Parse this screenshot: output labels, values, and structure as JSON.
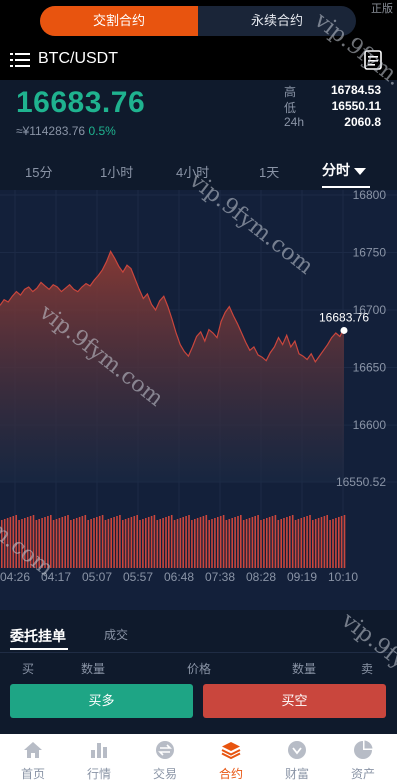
{
  "top": {
    "corner_text": "正版",
    "seg_delivery": "交割合约",
    "seg_perpetual": "永续合约"
  },
  "header": {
    "pair": "BTC/USDT"
  },
  "ticker": {
    "price": "16683.76",
    "cny": "≈¥114283.76",
    "change": "0.5%",
    "high_label": "高",
    "high": "16784.53",
    "low_label": "低",
    "low": "16550.11",
    "vol_label": "24h",
    "vol": "2060.8"
  },
  "intervals": [
    "15分",
    "1小时",
    "4小时",
    "1天",
    "分时"
  ],
  "active_interval": "分时",
  "chart_data": {
    "type": "area",
    "ylim": [
      16550.52,
      16800
    ],
    "y_ticks": [
      "16800",
      "16750",
      "16700",
      "16650",
      "16600",
      "16550.52"
    ],
    "x_ticks": [
      "04:26",
      "04:17",
      "05:07",
      "05:57",
      "06:48",
      "07:38",
      "08:28",
      "09:19",
      "10:10"
    ],
    "last_label": "16683.76",
    "values": [
      16704,
      16709,
      16707,
      16712,
      16716,
      16713,
      16718,
      16720,
      16716,
      16719,
      16724,
      16721,
      16718,
      16722,
      16720,
      16716,
      16719,
      16722,
      16718,
      16716,
      16720,
      16723,
      16721,
      16726,
      16730,
      16735,
      16742,
      16751,
      16745,
      16738,
      16733,
      16739,
      16736,
      16727,
      16718,
      16710,
      16714,
      16705,
      16700,
      16708,
      16712,
      16703,
      16692,
      16680,
      16670,
      16664,
      16660,
      16668,
      16677,
      16681,
      16673,
      16683,
      16680,
      16676,
      16690,
      16698,
      16703,
      16695,
      16688,
      16680,
      16672,
      16665,
      16668,
      16661,
      16659,
      16656,
      16663,
      16668,
      16676,
      16670,
      16678,
      16668,
      16673,
      16662,
      16660,
      16657,
      16662,
      16655,
      16660,
      16665,
      16670,
      16676,
      16680,
      16677,
      16684
    ],
    "up_color": "#c9463d",
    "down_color": "#1fb38f"
  },
  "watermark": "vip.9fym.com",
  "bottom": {
    "tab_orders": "委托挂单",
    "tab_trades": "成交",
    "col_buy": "买",
    "col_qty1": "数量",
    "col_price": "价格",
    "col_qty2": "数量",
    "col_sell": "卖",
    "btn_long": "买多",
    "btn_short": "买空"
  },
  "nav": [
    {
      "label": "首页",
      "icon": "home-icon"
    },
    {
      "label": "行情",
      "icon": "chart-bars-icon"
    },
    {
      "label": "交易",
      "icon": "exchange-icon"
    },
    {
      "label": "合约",
      "icon": "layers-icon"
    },
    {
      "label": "财富",
      "icon": "wallet-icon"
    },
    {
      "label": "资产",
      "icon": "pie-icon"
    }
  ],
  "nav_active": "合约"
}
